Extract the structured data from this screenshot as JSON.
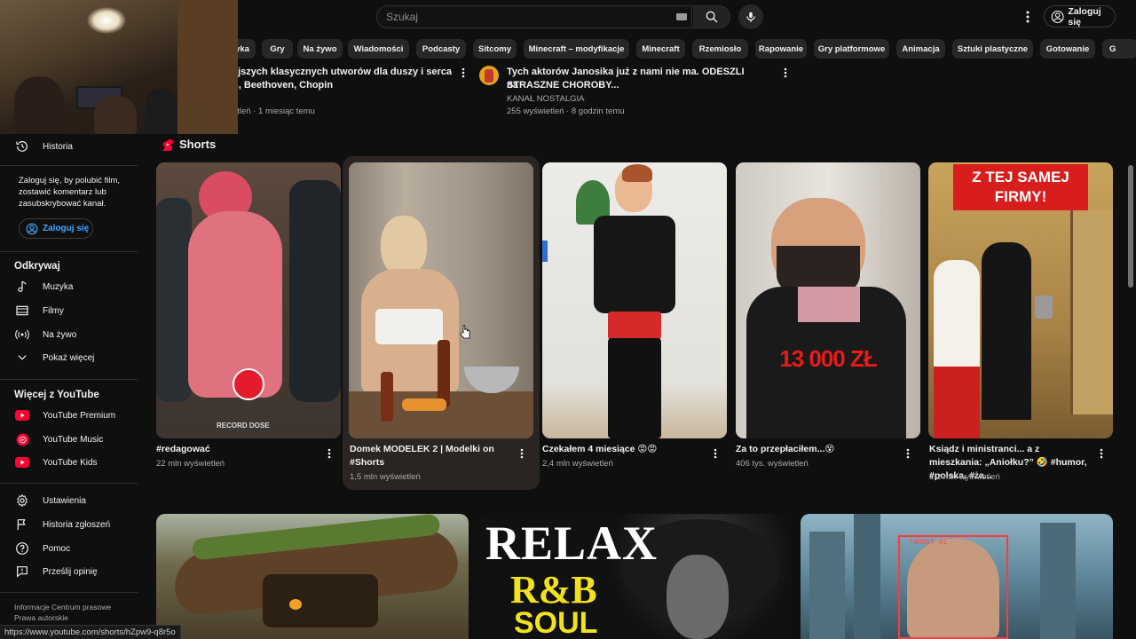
{
  "header": {
    "search_placeholder": "Szukaj",
    "signin_label": "Zaloguj się"
  },
  "chips": [
    "yka",
    "Gry",
    "Na żywo",
    "Wiadomości",
    "Podcasty",
    "Sitcomy",
    "Minecraft – modyfikacje",
    "Minecraft",
    "Rzemiosło",
    "Rapowanie",
    "Gry platformowe",
    "Animacja",
    "Sztuki plastyczne",
    "Gotowanie",
    "G"
  ],
  "sidebar": {
    "history_label": "Historia",
    "signin_note": "Zaloguj się, by polubić film, zostawić komentarz lub zasubskrybować kanał.",
    "signin_label": "Zaloguj się",
    "explore_heading": "Odkrywaj",
    "explore_items": [
      "Muzyka",
      "Filmy",
      "Na żywo",
      "Pokaż więcej"
    ],
    "more_heading": "Więcej z YouTube",
    "more_items": [
      "YouTube Premium",
      "YouTube Music",
      "YouTube Kids"
    ],
    "settings_items": [
      "Ustawienia",
      "Historia zgłoszeń",
      "Pomoc",
      "Prześlij opinię"
    ],
    "footer_line1": "Informacje   Centrum prasowe",
    "footer_line2": "Prawa autorskie"
  },
  "top_videos": [
    {
      "title_line1": "ejszych klasycznych utworów dla duszy i serca ♫",
      "title_line2": "n, Beethoven, Chopin",
      "channel": "h",
      "meta": "etleń · 1 miesiąc temu"
    },
    {
      "title_line1": "Tych aktorów Janosika już z nami nie ma. ODESZLI na",
      "title_line2": "STRASZNE CHOROBY...",
      "channel": "KANAŁ NOSTALGIA",
      "meta": "255 wyświetleń · 8 godzin temu"
    }
  ],
  "shorts": {
    "heading": "Shorts",
    "items": [
      {
        "title": "#redagować",
        "views": "22 mln wyświetleń",
        "overlay_text": "RECORD DOSE"
      },
      {
        "title": "Domek MODELEK 2 | Modelki on #Shorts",
        "views": "1,5 mln wyświetleń",
        "overlay_text": ""
      },
      {
        "title": "Czekałem 4 miesiące 😡😡",
        "views": "2,4 mln wyświetleń",
        "overlay_text": ""
      },
      {
        "title": "Za to przepłaciłem...😵",
        "views": "406 tys. wyświetleń",
        "overlay_text": "13 000 ZŁ"
      },
      {
        "title": "Ksiądz i ministranci... a z mieszkania: „Aniołku?” 🤣 #humor, #polska, #ża...",
        "views": "1,2 mln wyświetleń",
        "overlay_text": "Z TEJ SAMEJ FIRMY!"
      }
    ]
  },
  "bottom_thumbs": [
    {
      "overlay": ""
    },
    {
      "overlay_line1": "RELAX",
      "overlay_line2": "R&B",
      "overlay_line3": "SOUL"
    },
    {
      "overlay": "TARGET 01"
    }
  ],
  "statusbar": {
    "url": "https://www.youtube.com/shorts/hZpw9-q8r5o"
  },
  "colors": {
    "background": "#0f0f0f",
    "chip": "#272727",
    "accent_red": "#ff0033",
    "link_blue": "#3ea6ff",
    "muted_text": "#aaaaaa"
  }
}
